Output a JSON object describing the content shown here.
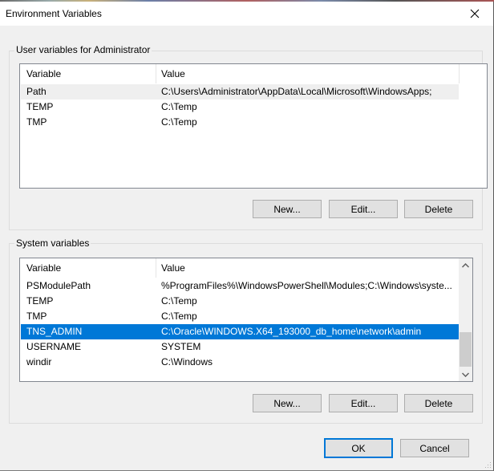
{
  "window": {
    "title": "Environment Variables",
    "close_icon": "close-icon"
  },
  "user_vars": {
    "group_label": "User variables for Administrator",
    "columns": [
      "Variable",
      "Value"
    ],
    "rows": [
      {
        "variable": "Path",
        "value": "C:\\Users\\Administrator\\AppData\\Local\\Microsoft\\WindowsApps;",
        "state": "hover"
      },
      {
        "variable": "TEMP",
        "value": "C:\\Temp",
        "state": ""
      },
      {
        "variable": "TMP",
        "value": "C:\\Temp",
        "state": ""
      }
    ],
    "buttons": {
      "new": "New...",
      "edit": "Edit...",
      "delete": "Delete"
    }
  },
  "system_vars": {
    "group_label": "System variables",
    "columns": [
      "Variable",
      "Value"
    ],
    "rows": [
      {
        "variable": "PSModulePath",
        "value": "%ProgramFiles%\\WindowsPowerShell\\Modules;C:\\Windows\\syste...",
        "state": ""
      },
      {
        "variable": "TEMP",
        "value": "C:\\Temp",
        "state": ""
      },
      {
        "variable": "TMP",
        "value": "C:\\Temp",
        "state": ""
      },
      {
        "variable": "TNS_ADMIN",
        "value": "C:\\Oracle\\WINDOWS.X64_193000_db_home\\network\\admin",
        "state": "selected"
      },
      {
        "variable": "USERNAME",
        "value": "SYSTEM",
        "state": ""
      },
      {
        "variable": "windir",
        "value": "C:\\Windows",
        "state": ""
      }
    ],
    "buttons": {
      "new": "New...",
      "edit": "Edit...",
      "delete": "Delete"
    },
    "scrollbar": {
      "up_icon": "chevron-up-icon",
      "down_icon": "chevron-down-icon"
    }
  },
  "footer": {
    "ok": "OK",
    "cancel": "Cancel"
  },
  "colors": {
    "selection": "#0078d7",
    "hover_row": "#efefef",
    "button_face": "#e1e1e1",
    "button_border": "#adadad",
    "dialog_bg": "#f0f0f0"
  }
}
